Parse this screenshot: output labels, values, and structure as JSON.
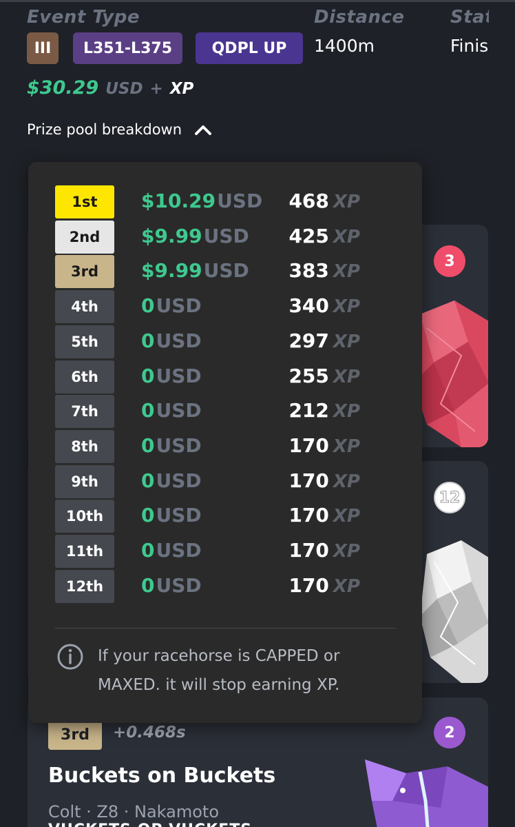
{
  "header": {
    "event_type_label": "Event Type",
    "distance_label": "Distance",
    "status_label": "Stat",
    "chips": [
      {
        "label": "III",
        "color": "#7a5a45"
      },
      {
        "label": "L351-L375",
        "color": "#5b3f85"
      },
      {
        "label": "QDPL UP",
        "color": "#4a3590"
      }
    ],
    "distance_value": "1400m",
    "status_value": "Finis"
  },
  "prize": {
    "amount": "$30.29",
    "unit": "USD",
    "plus": "+",
    "xp": "XP"
  },
  "breakdown": {
    "label": "Prize pool breakdown",
    "icon": "chevron-up-icon"
  },
  "prize_table": [
    {
      "place": "1st",
      "usd": "$10.29",
      "xp": "468"
    },
    {
      "place": "2nd",
      "usd": "$9.99",
      "xp": "425"
    },
    {
      "place": "3rd",
      "usd": "$9.99",
      "xp": "383"
    },
    {
      "place": "4th",
      "usd": "0",
      "xp": "340"
    },
    {
      "place": "5th",
      "usd": "0",
      "xp": "297"
    },
    {
      "place": "6th",
      "usd": "0",
      "xp": "255"
    },
    {
      "place": "7th",
      "usd": "0",
      "xp": "212"
    },
    {
      "place": "8th",
      "usd": "0",
      "xp": "170"
    },
    {
      "place": "9th",
      "usd": "0",
      "xp": "170"
    },
    {
      "place": "10th",
      "usd": "0",
      "xp": "170"
    },
    {
      "place": "11th",
      "usd": "0",
      "xp": "170"
    },
    {
      "place": "12th",
      "usd": "0",
      "xp": "170"
    }
  ],
  "units": {
    "usd": "USD",
    "xp": "XP"
  },
  "info": {
    "icon": "info-icon",
    "text": "If your racehorse is CAPPED or MAXED. it will stop earning XP."
  },
  "gates": [
    "3",
    "12",
    "2"
  ],
  "bottom_card": {
    "place": "3rd",
    "time_diff": "+0.468s",
    "horse_name": "Buckets on Buckets",
    "meta": "Colt · Z8 · Nakamoto",
    "sub": "VUCKETS OP VUCKETS"
  },
  "colors": {
    "accent_green": "#3ec98f",
    "gold": "#ffe600",
    "silver": "#e6e6e6",
    "bronze": "#c9b58a",
    "gate_red": "#ef4d6a",
    "gate_purple": "#9b59d0"
  }
}
